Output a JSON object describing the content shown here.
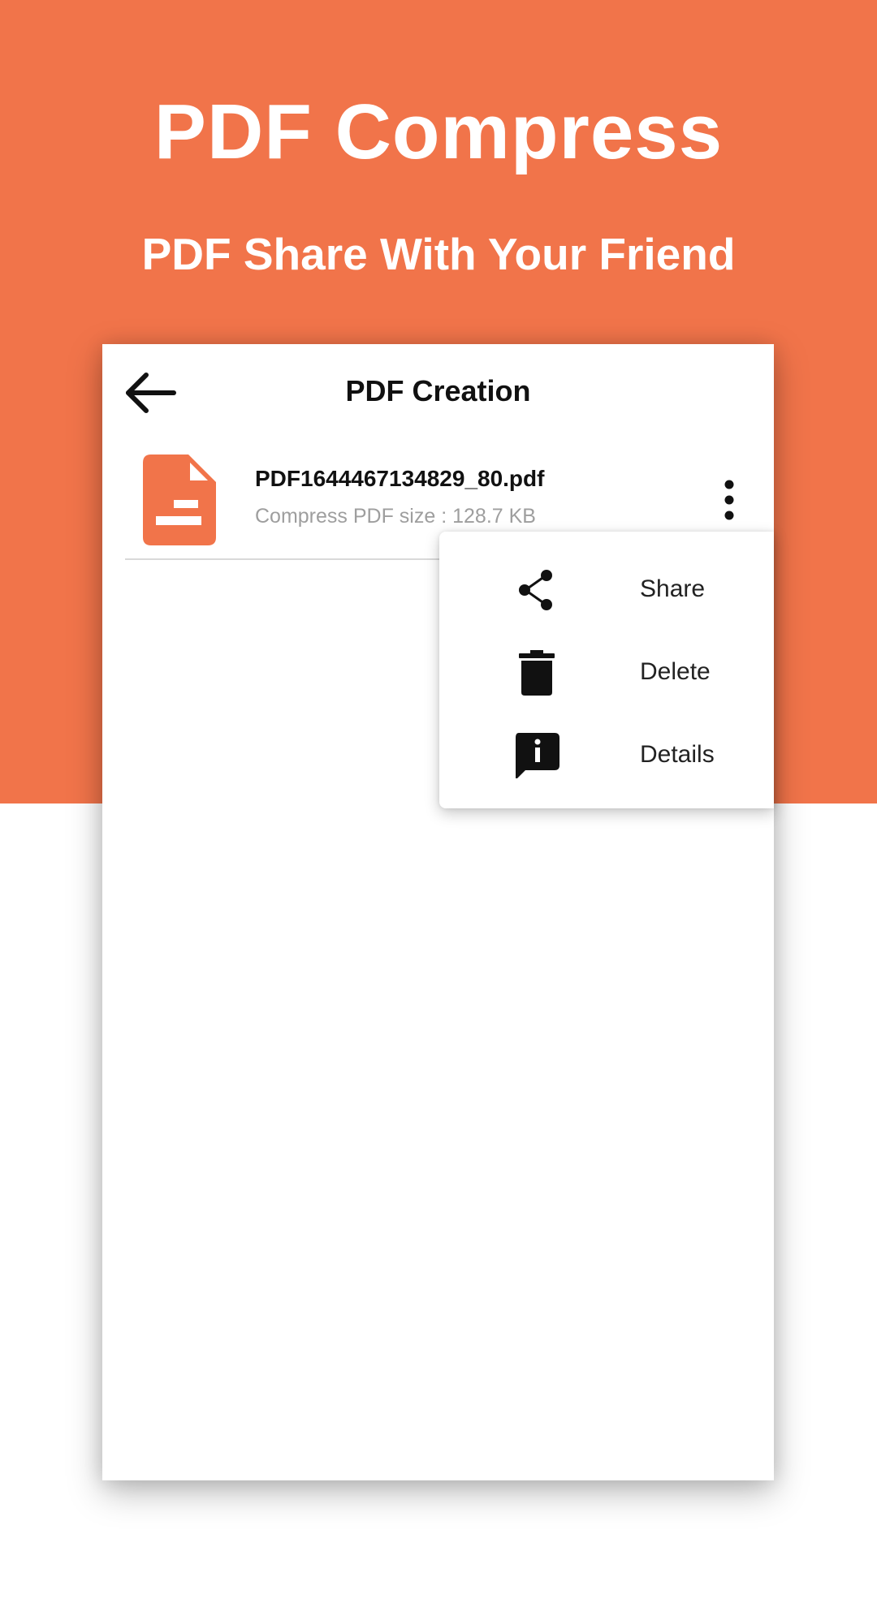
{
  "promo": {
    "title": "PDF Compress",
    "subtitle": "PDF Share With Your Friend"
  },
  "app_bar": {
    "title": "PDF Creation",
    "back_icon": "arrow-back-icon"
  },
  "files": [
    {
      "name": "PDF1644467134829_80.pdf",
      "size": "Compress PDF size : 128.7 KB",
      "icon": "pdf-file-icon",
      "menu_icon": "more-vert-icon"
    }
  ],
  "menu": {
    "items": [
      {
        "label": "Share",
        "icon": "share-icon"
      },
      {
        "label": "Delete",
        "icon": "trash-icon"
      },
      {
        "label": "Details",
        "icon": "info-icon"
      }
    ]
  },
  "colors": {
    "brand": "#f1744a",
    "text_primary": "#111111",
    "text_secondary": "#9e9e9e"
  }
}
